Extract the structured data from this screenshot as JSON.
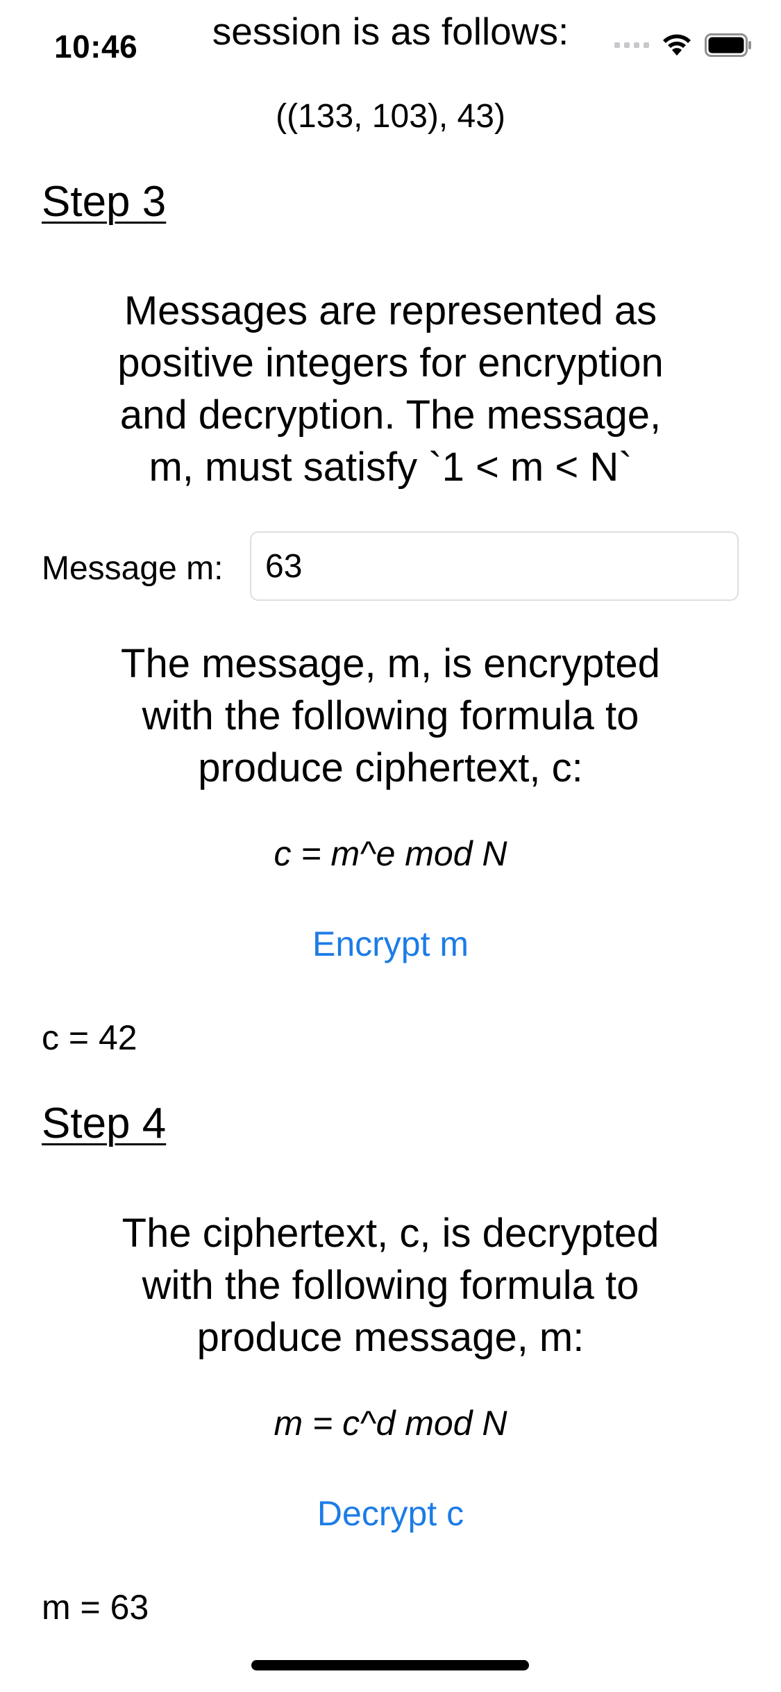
{
  "status_bar": {
    "time": "10:46"
  },
  "step2": {
    "cut_off_text": "session is as follows:",
    "key_pair": "((133, 103), 43)"
  },
  "step3": {
    "heading": "Step 3",
    "description_lines": [
      "Messages are represented as",
      "positive integers for encryption",
      "and decryption. The message,",
      "m, must satisfy `1 < m < N`"
    ],
    "input_label": "Message m:",
    "input_value": "63",
    "encrypt_description_lines": [
      "The message, m, is encrypted",
      "with the following formula to",
      "produce ciphertext, c:"
    ],
    "formula": "c = m^e mod N",
    "encrypt_button": "Encrypt m",
    "result": "c = 42"
  },
  "step4": {
    "heading": "Step 4",
    "description_lines": [
      "The ciphertext, c, is decrypted",
      "with the following formula to",
      "produce message, m:"
    ],
    "formula": "m = c^d mod N",
    "decrypt_button": "Decrypt c",
    "result": "m = 63"
  },
  "colors": {
    "link": "#1c7ce6",
    "input_border": "#dedede"
  }
}
